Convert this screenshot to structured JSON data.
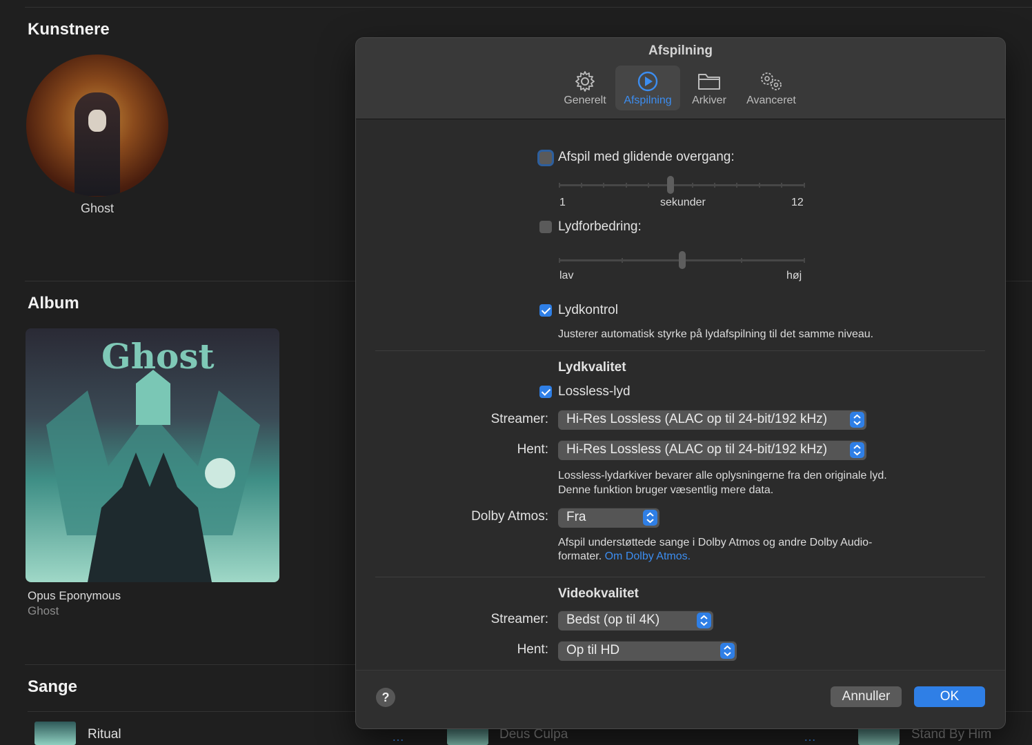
{
  "library": {
    "artists_title": "Kunstnere",
    "artist_name": "Ghost",
    "album_title": "Album",
    "album_name": "Opus Eponymous",
    "album_artist": "Ghost",
    "songs_title": "Sange",
    "songs": [
      {
        "title": "Ritual"
      },
      {
        "title": "Deus Culpa"
      },
      {
        "title": "Stand By Him"
      }
    ],
    "more_glyph": "…"
  },
  "dialog": {
    "title": "Afspilning",
    "tabs": [
      {
        "label": "Generelt",
        "icon": "gear-icon"
      },
      {
        "label": "Afspilning",
        "icon": "play-circle-icon",
        "active": true
      },
      {
        "label": "Arkiver",
        "icon": "folder-icon"
      },
      {
        "label": "Avanceret",
        "icon": "gears-icon"
      }
    ],
    "crossfade": {
      "label": "Afspil med glidende overgang:",
      "checked": false,
      "min_label": "1",
      "unit_label": "sekunder",
      "max_label": "12",
      "value": 6
    },
    "sound_enhancer": {
      "label": "Lydforbedring:",
      "checked": false,
      "low_label": "lav",
      "high_label": "høj",
      "value": 0.5
    },
    "sound_check": {
      "label": "Lydkontrol",
      "checked": true,
      "description": "Justerer automatisk styrke på lydafspilning til det samme niveau."
    },
    "audio_quality": {
      "heading": "Lydkvalitet",
      "lossless_label": "Lossless-lyd",
      "lossless_checked": true,
      "streaming_label": "Streamer:",
      "streaming_value": "Hi-Res Lossless (ALAC op til 24-bit/192 kHz)",
      "download_label": "Hent:",
      "download_value": "Hi-Res Lossless (ALAC op til 24-bit/192 kHz)",
      "note_line1": "Lossless-lydarkiver bevarer alle oplysningerne fra den originale lyd.",
      "note_line2": "Denne funktion bruger væsentlig mere data.",
      "dolby_label": "Dolby Atmos:",
      "dolby_value": "Fra",
      "dolby_note_line1": "Afspil understøttede sange i Dolby Atmos og andre Dolby Audio-",
      "dolby_note_line2": "formater.",
      "dolby_link": "Om Dolby Atmos."
    },
    "video_quality": {
      "heading": "Videokvalitet",
      "streaming_label": "Streamer:",
      "streaming_value": "Bedst (op til 4K)",
      "download_label": "Hent:",
      "download_value": "Op til HD"
    },
    "footer": {
      "help": "?",
      "cancel": "Annuller",
      "ok": "OK"
    }
  },
  "colors": {
    "accent": "#2f7fe6",
    "link": "#3c8df0",
    "background": "#1f1f1f",
    "dialog": "#2b2b2b"
  }
}
